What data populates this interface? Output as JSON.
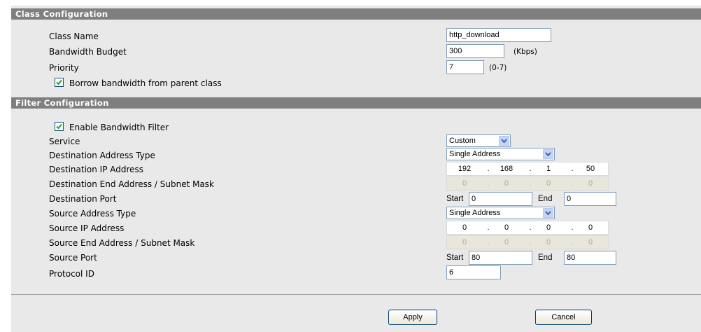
{
  "class_config": {
    "header": "Class Configuration",
    "class_name_label": "Class Name",
    "class_name_value": "http_download",
    "bandwidth_budget_label": "Bandwidth Budget",
    "bandwidth_budget_value": "300",
    "bandwidth_unit": "(Kbps)",
    "priority_label": "Priority",
    "priority_value": "7",
    "priority_range": "(0-7)",
    "borrow_label": "Borrow bandwidth from parent class",
    "borrow_checked": true
  },
  "filter_config": {
    "header": "Filter Configuration",
    "enable_filter_label": "Enable Bandwidth Filter",
    "enable_filter_checked": true,
    "service_label": "Service",
    "service_value": "Custom",
    "dest_addr_type_label": "Destination Address Type",
    "dest_addr_type_value": "Single Address",
    "dest_ip_label": "Destination IP Address",
    "dest_ip": [
      "192",
      "168",
      "1",
      "50"
    ],
    "dest_end_label": "Destination End Address / Subnet Mask",
    "dest_end": [
      "0",
      "0",
      "0",
      "0"
    ],
    "dest_port_label": "Destination Port",
    "dest_port_start": "0",
    "dest_port_end": "0",
    "src_addr_type_label": "Source Address Type",
    "src_addr_type_value": "Single Address",
    "src_ip_label": "Source IP Address",
    "src_ip": [
      "0",
      "0",
      "0",
      "0"
    ],
    "src_end_label": "Source End Address / Subnet Mask",
    "src_end": [
      "0",
      "0",
      "0",
      "0"
    ],
    "src_port_label": "Source Port",
    "src_port_start": "80",
    "src_port_end": "80",
    "protocol_label": "Protocol ID",
    "protocol_value": "6",
    "start_label": "Start",
    "end_label": "End",
    "ip_separator": "."
  },
  "buttons": {
    "apply": "Apply",
    "cancel": "Cancel"
  }
}
